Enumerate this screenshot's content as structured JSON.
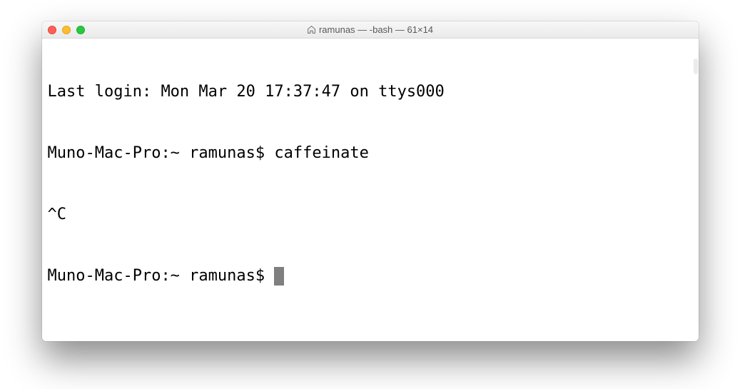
{
  "titlebar": {
    "icon": "home-icon",
    "title": "ramunas — -bash — 61×14"
  },
  "terminal": {
    "lines": [
      "Last login: Mon Mar 20 17:37:47 on ttys000",
      "Muno-Mac-Pro:~ ramunas$ caffeinate",
      "^C"
    ],
    "prompt": "Muno-Mac-Pro:~ ramunas$ "
  }
}
